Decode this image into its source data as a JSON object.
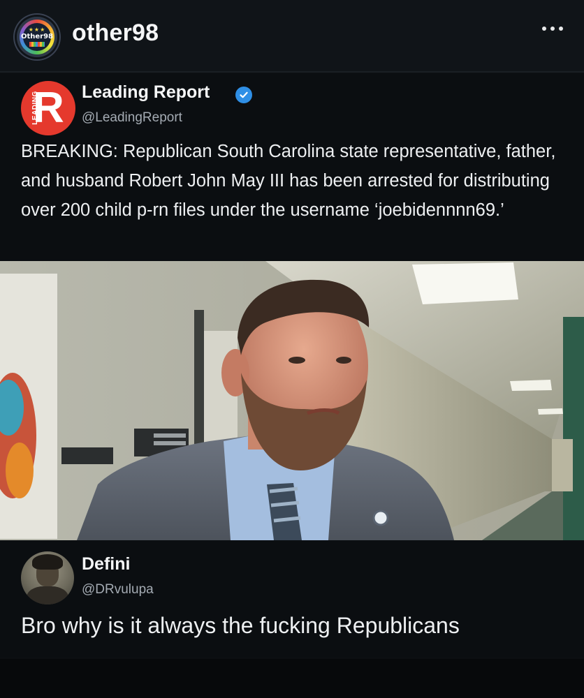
{
  "post": {
    "username": "other98",
    "avatar_text": "Other98",
    "more_icon": "more-horizontal-icon"
  },
  "tweet": {
    "author_name": "Leading Report",
    "author_handle": "@LeadingReport",
    "avatar_letter": "R",
    "avatar_side_text": "LEADING",
    "verified": true,
    "verified_color": "#2f8fe6",
    "text": "BREAKING: Republican South Carolina state representative, father, and husband Robert John May III has been arrested for distributing over 200 child p-rn files under the username ‘joebidennnn69.’"
  },
  "photo": {
    "subject": "news-photo"
  },
  "reply": {
    "author_name": "Defini",
    "author_handle": "@DRvulupa",
    "text": "Bro why is it always the fucking Republicans"
  },
  "colors": {
    "background": "#0c0f12",
    "text": "#eef0f2",
    "muted": "#a4abb3",
    "brand_red": "#e5392d"
  }
}
